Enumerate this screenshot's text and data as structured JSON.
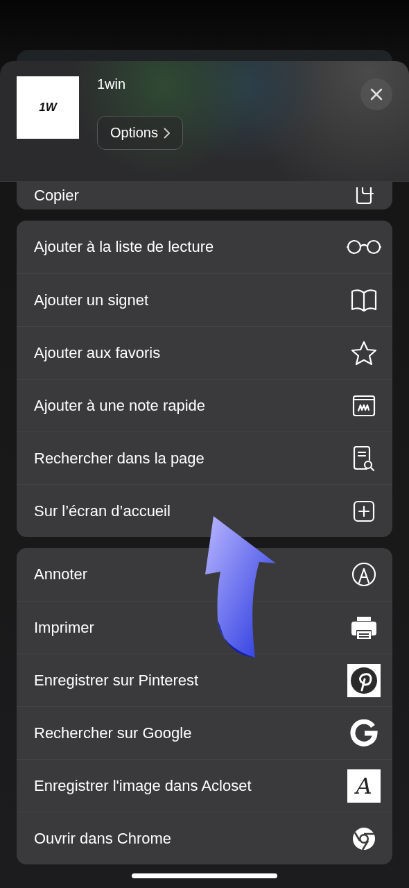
{
  "header": {
    "logo_text": "1W",
    "title": "1win",
    "options_button": "Options"
  },
  "copy_row": {
    "label": "Copier"
  },
  "groups": [
    {
      "items": [
        {
          "label": "Ajouter à la liste de lecture"
        },
        {
          "label": "Ajouter un signet"
        },
        {
          "label": "Ajouter aux favoris"
        },
        {
          "label": "Ajouter à une note rapide"
        },
        {
          "label": "Rechercher dans la page"
        },
        {
          "label": "Sur l’écran d’accueil"
        }
      ]
    },
    {
      "items": [
        {
          "label": "Annoter"
        },
        {
          "label": "Imprimer"
        },
        {
          "label": "Enregistrer sur Pinterest"
        },
        {
          "label": "Rechercher sur Google"
        },
        {
          "label": "Enregistrer l'image dans Acloset",
          "icon_letter": "A"
        },
        {
          "label": "Ouvrir dans Chrome"
        }
      ]
    }
  ]
}
